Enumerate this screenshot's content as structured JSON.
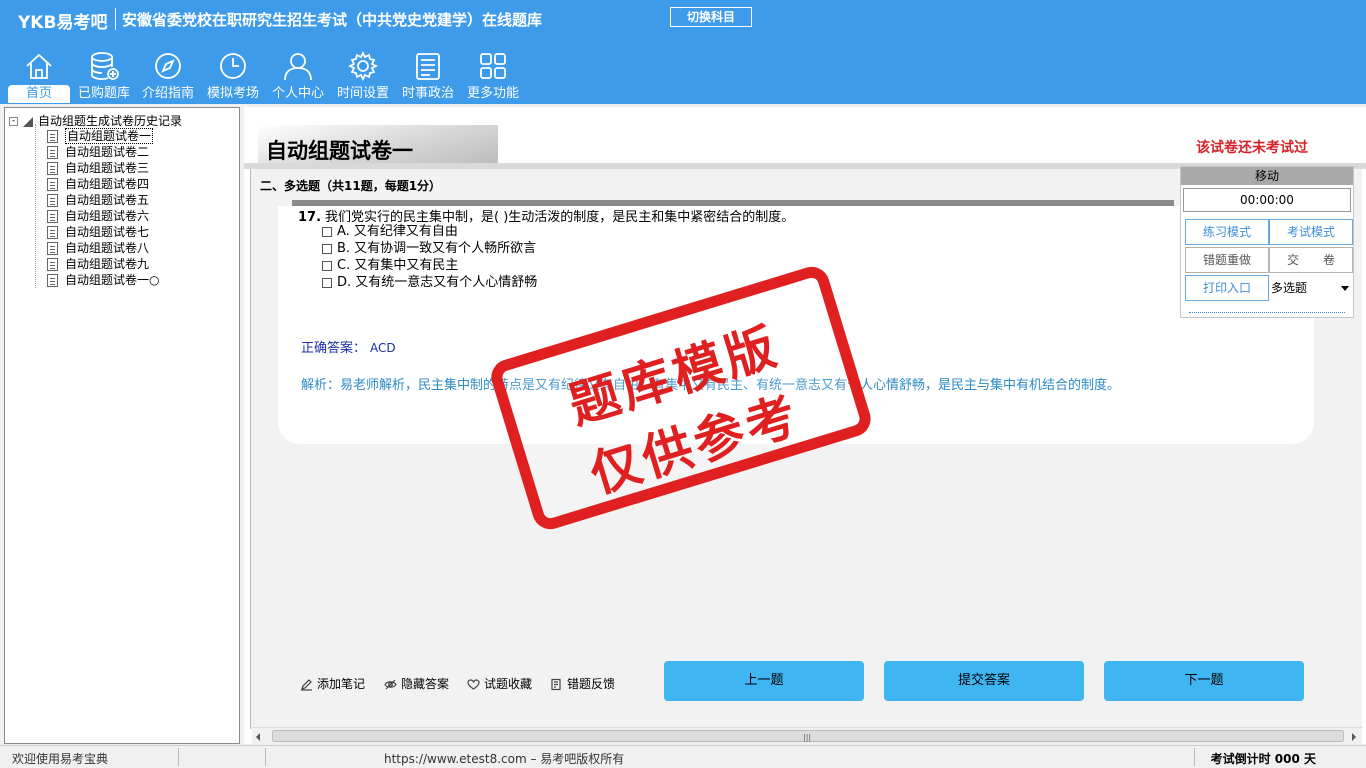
{
  "header": {
    "brand": "YKB易考吧",
    "title": "安徽省委党校在职研究生招生考试（中共党史党建学）在线题库",
    "switch_label": "切换科目",
    "bg_color": "#3d9be9",
    "nav": [
      {
        "label": "首页",
        "icon": "home-icon"
      },
      {
        "label": "已购题库",
        "icon": "database-icon"
      },
      {
        "label": "介绍指南",
        "icon": "compass-icon"
      },
      {
        "label": "模拟考场",
        "icon": "clock-icon"
      },
      {
        "label": "个人中心",
        "icon": "user-icon"
      },
      {
        "label": "时间设置",
        "icon": "gear-icon"
      },
      {
        "label": "时事政治",
        "icon": "newspaper-icon"
      },
      {
        "label": "更多功能",
        "icon": "grid-icon"
      }
    ]
  },
  "tree": {
    "root_label": "自动组题生成试卷历史记录",
    "toggle": "-",
    "items": [
      "自动组题试卷一",
      "自动组题试卷二",
      "自动组题试卷三",
      "自动组题试卷四",
      "自动组题试卷五",
      "自动组题试卷六",
      "自动组题试卷七",
      "自动组题试卷八",
      "自动组题试卷九",
      "自动组题试卷一○"
    ]
  },
  "main": {
    "paper_title": "自动组题试卷一",
    "status": "该试卷还未考试过",
    "status_color": "#d4232a",
    "section": "二、多选题（共11题，每题1分）",
    "question": {
      "number": "17.",
      "text": "我们党实行的民主集中制，是( )生动活泼的制度，是民主和集中紧密结合的制度。",
      "options": [
        "A. 又有纪律又有自由",
        "B. 又有协调一致又有个人畅所欲言",
        "C. 又有集中又有民主",
        "D. 又有统一意志又有个人心情舒畅"
      ]
    },
    "answer_label": "正确答案：",
    "answer_value": "ACD",
    "analysis": "解析：易老师解析，民主集中制的特点是又有纪律又有自由、有集中又有民主、有统一意志又有个人心情舒畅，是民主与集中有机结合的制度。",
    "analysis_color": "#2c8ac6"
  },
  "stamp": {
    "line1": "题库模版",
    "line2": "仅供参考",
    "color": "#e02020"
  },
  "control": {
    "header": "移动",
    "timer": "00:00:00",
    "practice_mode": "练习模式",
    "exam_mode": "考试模式",
    "redo_wrong": "错题重做",
    "submit_paper": "交　　卷",
    "print_entry": "打印入口",
    "question_type": "多选题"
  },
  "tools": {
    "add_note": "添加笔记",
    "hide_answer": "隐藏答案",
    "favorite": "试题收藏",
    "report_error": "错题反馈"
  },
  "buttons": {
    "prev": "上一题",
    "submit": "提交答案",
    "next": "下一题",
    "color": "#3fb6f2"
  },
  "statusbar": {
    "welcome": "欢迎使用易考宝典",
    "url": "https://www.etest8.com – 易考吧版权所有",
    "countdown": "考试倒计时 000 天"
  }
}
